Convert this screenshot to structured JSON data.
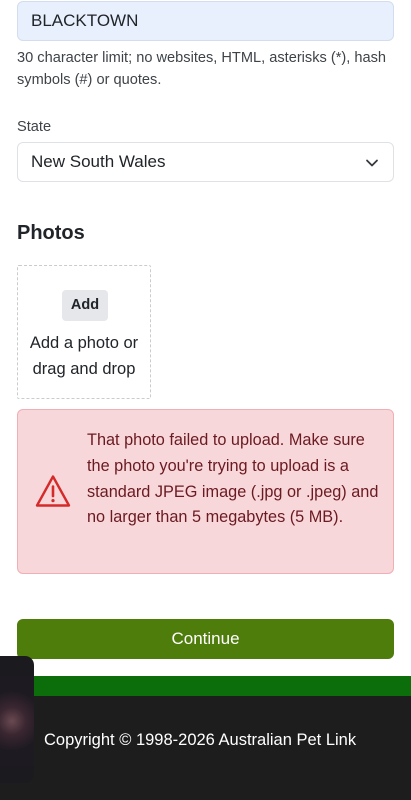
{
  "form": {
    "suburb_value": "BLACKTOWN",
    "suburb_help": "30 character limit; no websites, HTML, asterisks (*), hash symbols (#) or quotes.",
    "state_label": "State",
    "state_value": "New South Wales",
    "photos_heading": "Photos",
    "add_button": "Add",
    "dropzone_text": "Add a photo or drag and drop",
    "error_message": "That photo failed to upload. Make sure the photo you're trying to upload is a standard JPEG image (.jpg or .jpeg) and no larger than 5 megabytes (5 MB).",
    "continue_button": "Continue"
  },
  "footer": {
    "copyright": "Copyright © 1998-2026 Australian Pet Link"
  },
  "colors": {
    "continue": "#4e7d0c",
    "alert_bg": "#f8d7da",
    "alert_text": "#6a1a21",
    "footer_band": "#0b6e0b",
    "footer_bg": "#1d1d1d"
  },
  "icons": {
    "select_caret": "chevron-down-icon",
    "alert": "warning-icon"
  }
}
